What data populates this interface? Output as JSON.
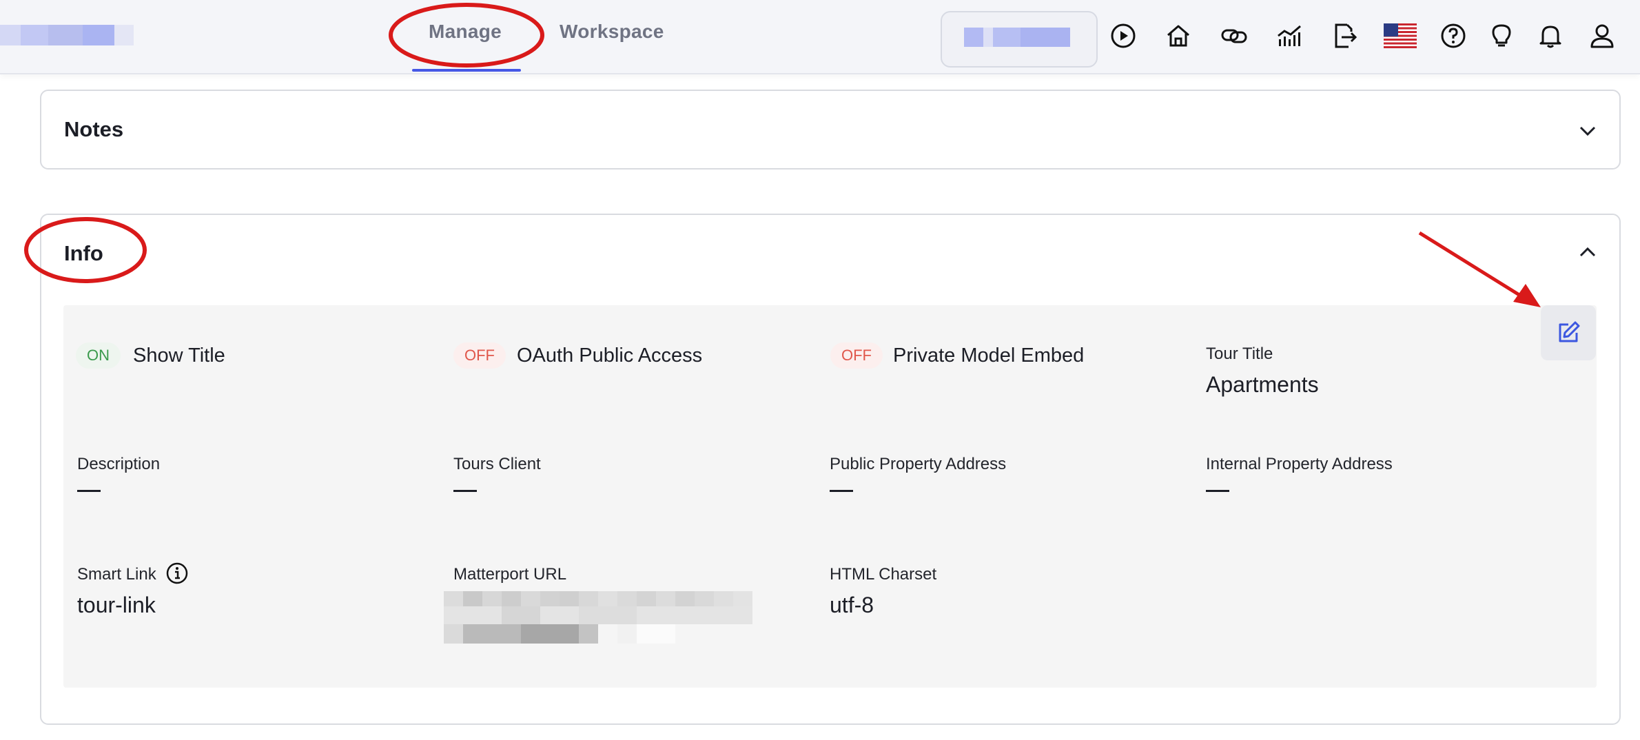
{
  "nav": {
    "tabs": [
      {
        "label": "Manage",
        "active": true
      },
      {
        "label": "Workspace",
        "active": false
      }
    ],
    "icons": [
      "play-icon",
      "home-icon",
      "link-icon",
      "analytics-icon",
      "share-icon",
      "us-flag-icon",
      "help-icon",
      "lightbulb-icon",
      "bell-icon",
      "user-icon"
    ]
  },
  "notes": {
    "title": "Notes"
  },
  "info": {
    "title": "Info",
    "toggles": [
      {
        "state": "ON",
        "label": "Show Title"
      },
      {
        "state": "OFF",
        "label": "OAuth Public Access"
      },
      {
        "state": "OFF",
        "label": "Private Model Embed"
      }
    ],
    "tour_title": {
      "label": "Tour Title",
      "value": "Apartments"
    },
    "description": {
      "label": "Description",
      "value": "—"
    },
    "tours_client": {
      "label": "Tours Client",
      "value": "—"
    },
    "public_address": {
      "label": "Public Property Address",
      "value": "—"
    },
    "internal_address": {
      "label": "Internal Property Address",
      "value": "—"
    },
    "smart_link": {
      "label": "Smart Link",
      "value": "tour-link"
    },
    "matterport_url": {
      "label": "Matterport URL"
    },
    "html_charset": {
      "label": "HTML Charset",
      "value": "utf-8"
    }
  },
  "colors": {
    "accent": "#4658e6",
    "on_badge": "#3a9a4c",
    "off_badge": "#e0574b",
    "annotation_red": "#d91a1a"
  }
}
